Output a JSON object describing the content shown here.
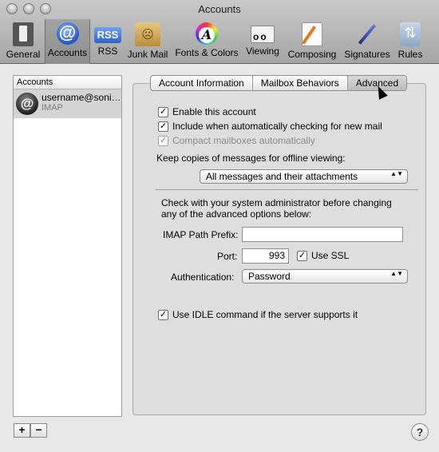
{
  "window": {
    "title": "Accounts"
  },
  "toolbar": {
    "items": [
      {
        "label": "General",
        "icon": "light-switch-icon"
      },
      {
        "label": "Accounts",
        "icon": "at-sign-icon",
        "selected": true
      },
      {
        "label": "RSS",
        "icon": "rss-icon"
      },
      {
        "label": "Junk Mail",
        "icon": "junk-bag-icon"
      },
      {
        "label": "Fonts & Colors",
        "icon": "color-wheel-icon"
      },
      {
        "label": "Viewing",
        "icon": "glasses-icon"
      },
      {
        "label": "Composing",
        "icon": "pencil-paper-icon"
      },
      {
        "label": "Signatures",
        "icon": "pen-icon"
      },
      {
        "label": "Rules",
        "icon": "rules-icon"
      }
    ],
    "accounts_glyph": "@",
    "rss_glyph": "RSS",
    "fonts_glyph": "A"
  },
  "sidebar": {
    "header": "Accounts",
    "accounts": [
      {
        "name": "username@soni…",
        "type": "IMAP",
        "glyph": "@"
      }
    ],
    "add_label": "+",
    "remove_label": "−"
  },
  "tabs": [
    {
      "label": "Account Information"
    },
    {
      "label": "Mailbox Behaviors"
    },
    {
      "label": "Advanced",
      "active": true
    }
  ],
  "advanced": {
    "enable_account": {
      "label": "Enable this account",
      "checked": true,
      "mark": "✓"
    },
    "include_check": {
      "label": "Include when automatically checking for new mail",
      "checked": true,
      "mark": "✓"
    },
    "compact": {
      "label": "Compact mailboxes automatically",
      "checked": true,
      "disabled": true,
      "mark": "✓"
    },
    "offline_label": "Keep copies of messages for offline viewing:",
    "offline_value": "All messages and their attachments",
    "admin_note_line1": "Check with your system administrator before changing",
    "admin_note_line2": "any of the advanced options below:",
    "imap_prefix_label": "IMAP Path Prefix:",
    "imap_prefix_value": "",
    "port_label": "Port:",
    "port_value": "993",
    "ssl": {
      "label": "Use SSL",
      "checked": true,
      "mark": "✓"
    },
    "auth_label": "Authentication:",
    "auth_value": "Password",
    "idle": {
      "label": "Use IDLE command if the server supports it",
      "checked": true,
      "mark": "✓"
    }
  },
  "help_label": "?",
  "select_arrows": "▲▼"
}
